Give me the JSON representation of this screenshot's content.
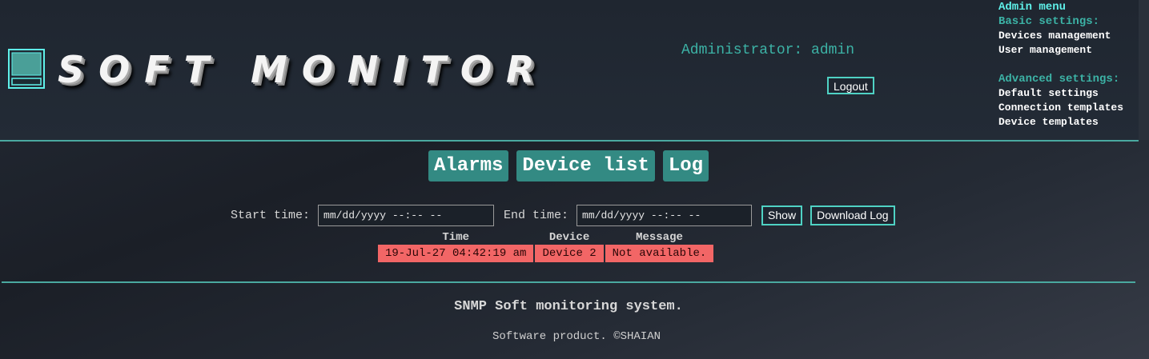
{
  "header": {
    "logo_text": "SOFT MONITOR",
    "admin_label": "Administrator: admin",
    "logout_label": "Logout"
  },
  "admin_menu": {
    "title": "Admin menu",
    "basic_title": "Basic settings:",
    "basic_items": [
      "Devices management",
      "User management"
    ],
    "advanced_title": "Advanced settings:",
    "advanced_items": [
      "Default settings",
      "Connection templates",
      "Device templates"
    ]
  },
  "tabs": [
    "Alarms",
    "Device list",
    "Log"
  ],
  "filter": {
    "start_label": "Start time:",
    "start_placeholder": "mm/dd/yyyy --:-- --",
    "end_label": "End time:",
    "end_placeholder": "mm/dd/yyyy --:-- --",
    "show_label": "Show",
    "download_label": "Download Log"
  },
  "log_table": {
    "headers": [
      "Time",
      "Device",
      "Message"
    ],
    "rows": [
      [
        "19-Jul-27 04:42:19 am",
        "Device 2",
        "Not available."
      ]
    ]
  },
  "footer": {
    "title": "SNMP Soft monitoring system.",
    "copyright": "Software product. ©SHAIAN"
  },
  "colors": {
    "accent": "#3cb3a6",
    "button_border": "#4fd2c4",
    "tab_bg": "#338a83",
    "alarm_row": "#f26666"
  }
}
